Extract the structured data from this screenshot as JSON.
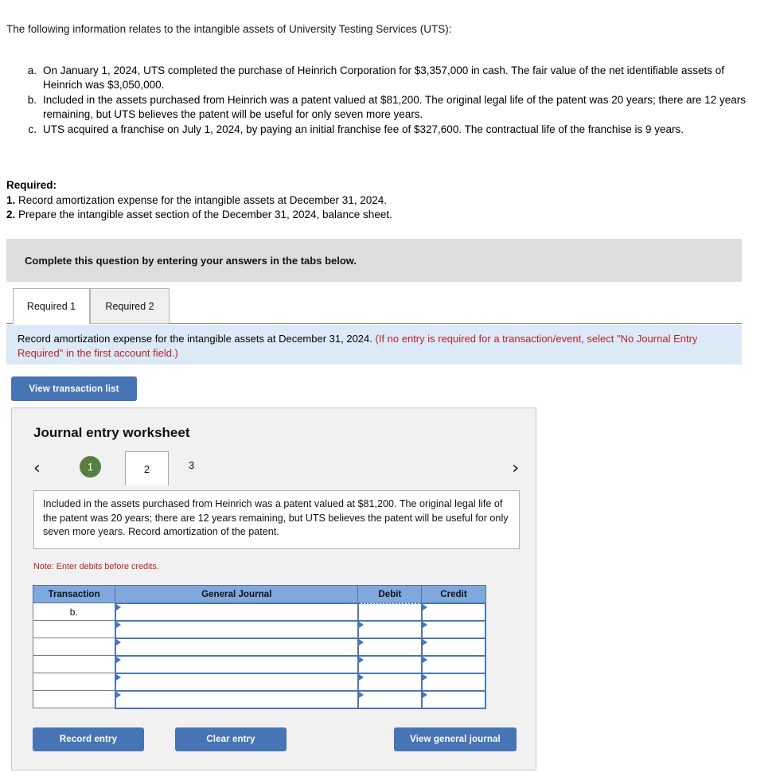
{
  "intro": "The following information relates to the intangible assets of University Testing Services (UTS):",
  "facts": [
    {
      "letter": "a.",
      "text": "On January 1, 2024, UTS completed the purchase of Heinrich Corporation for $3,357,000 in cash. The fair value of the net identifiable assets of Heinrich was $3,050,000."
    },
    {
      "letter": "b.",
      "text": "Included in the assets purchased from Heinrich was a patent valued at $81,200. The original legal life of the patent was 20 years; there are 12 years remaining, but UTS believes the patent will be useful for only seven more years."
    },
    {
      "letter": "c.",
      "text": "UTS acquired a franchise on July 1, 2024, by paying an initial franchise fee of $327,600. The contractual life of the franchise is 9 years."
    }
  ],
  "required": {
    "title": "Required:",
    "items": [
      {
        "num": "1.",
        "text": "Record amortization expense for the intangible assets at December 31, 2024."
      },
      {
        "num": "2.",
        "text": "Prepare the intangible asset section of the December 31, 2024, balance sheet."
      }
    ]
  },
  "gray_banner": {
    "text": "Complete this question by entering your answers in the tabs below."
  },
  "tabs": [
    {
      "label": "Required 1",
      "active": true
    },
    {
      "label": "Required 2",
      "active": false
    }
  ],
  "blue_banner": {
    "text": "Record amortization expense for the intangible assets at December 31, 2024.",
    "red_text": "(If no entry is required for a transaction/event, select \"No Journal Entry Required\" in the first account field.)"
  },
  "view_transaction_button": "View transaction list",
  "worksheet": {
    "title": "Journal entry worksheet",
    "pager": {
      "prev_icon": "chevron-left",
      "next_icon": "chevron-right",
      "prev_glyph": "‹",
      "next_glyph": "›",
      "pages": [
        {
          "label": "1",
          "state": "completed"
        },
        {
          "label": "2",
          "state": "active"
        },
        {
          "label": "3",
          "state": "pending"
        }
      ]
    },
    "description": "Included in the assets purchased from Heinrich was a patent valued at $81,200. The original legal life of the patent was 20 years; there are 12 years remaining, but UTS believes the patent will be useful for only seven more years. Record amortization of the patent.",
    "note": "Note: Enter debits before credits.",
    "table": {
      "headers": [
        "Transaction",
        "General Journal",
        "Debit",
        "Credit"
      ],
      "rows": [
        {
          "transaction": "b.",
          "general_journal": "",
          "debit": "",
          "credit": "",
          "debit_selected": true
        },
        {
          "transaction": "",
          "general_journal": "",
          "debit": "",
          "credit": "",
          "debit_selected": false
        },
        {
          "transaction": "",
          "general_journal": "",
          "debit": "",
          "credit": "",
          "debit_selected": false
        },
        {
          "transaction": "",
          "general_journal": "",
          "debit": "",
          "credit": "",
          "debit_selected": false
        },
        {
          "transaction": "",
          "general_journal": "",
          "debit": "",
          "credit": "",
          "debit_selected": false
        },
        {
          "transaction": "",
          "general_journal": "",
          "debit": "",
          "credit": "",
          "debit_selected": false
        }
      ]
    },
    "buttons": {
      "record": "Record entry",
      "clear": "Clear entry",
      "view_general_journal": "View general journal"
    }
  },
  "colors": {
    "button_blue": "#4774b4",
    "table_header_blue": "#7fa8dd",
    "cell_outline_blue": "#4a77b4",
    "badge_green": "#55803f",
    "banner_gray": "#dddddd",
    "banner_blue": "#dce9f7",
    "note_red": "#b22626",
    "panel_gray": "#f1f1f1"
  }
}
